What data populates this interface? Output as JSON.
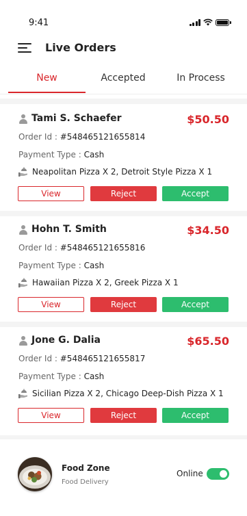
{
  "status_bar": {
    "time": "9:41"
  },
  "header": {
    "title": "Live Orders"
  },
  "tabs": [
    {
      "label": "New",
      "active": true
    },
    {
      "label": "Accepted",
      "active": false
    },
    {
      "label": "In Process",
      "active": false
    }
  ],
  "labels": {
    "order_id_prefix": "Order Id : ",
    "payment_prefix": "Payment Type : ",
    "view": "View",
    "reject": "Reject",
    "accept": "Accept"
  },
  "orders": [
    {
      "customer": "Tami S. Schaefer",
      "amount": "$50.50",
      "order_id": "#548465121655814",
      "payment_type": "Cash",
      "items": "Neapolitan Pizza X 2, Detroit Style Pizza X 1"
    },
    {
      "customer": "Hohn T. Smith",
      "amount": "$34.50",
      "order_id": "#548465121655816",
      "payment_type": "Cash",
      "items": "Hawaiian Pizza X 2, Greek Pizza X 1"
    },
    {
      "customer": "Jone G. Dalia",
      "amount": "$65.50",
      "order_id": "#548465121655817",
      "payment_type": "Cash",
      "items": "Sicilian Pizza X 2, Chicago Deep-Dish Pizza X 1"
    }
  ],
  "footer": {
    "store_name": "Food Zone",
    "store_type": "Food Delivery",
    "online_label": "Online",
    "online": true
  },
  "colors": {
    "accent": "#d9262b",
    "reject": "#e03a3e",
    "accept": "#2dbd6e"
  }
}
